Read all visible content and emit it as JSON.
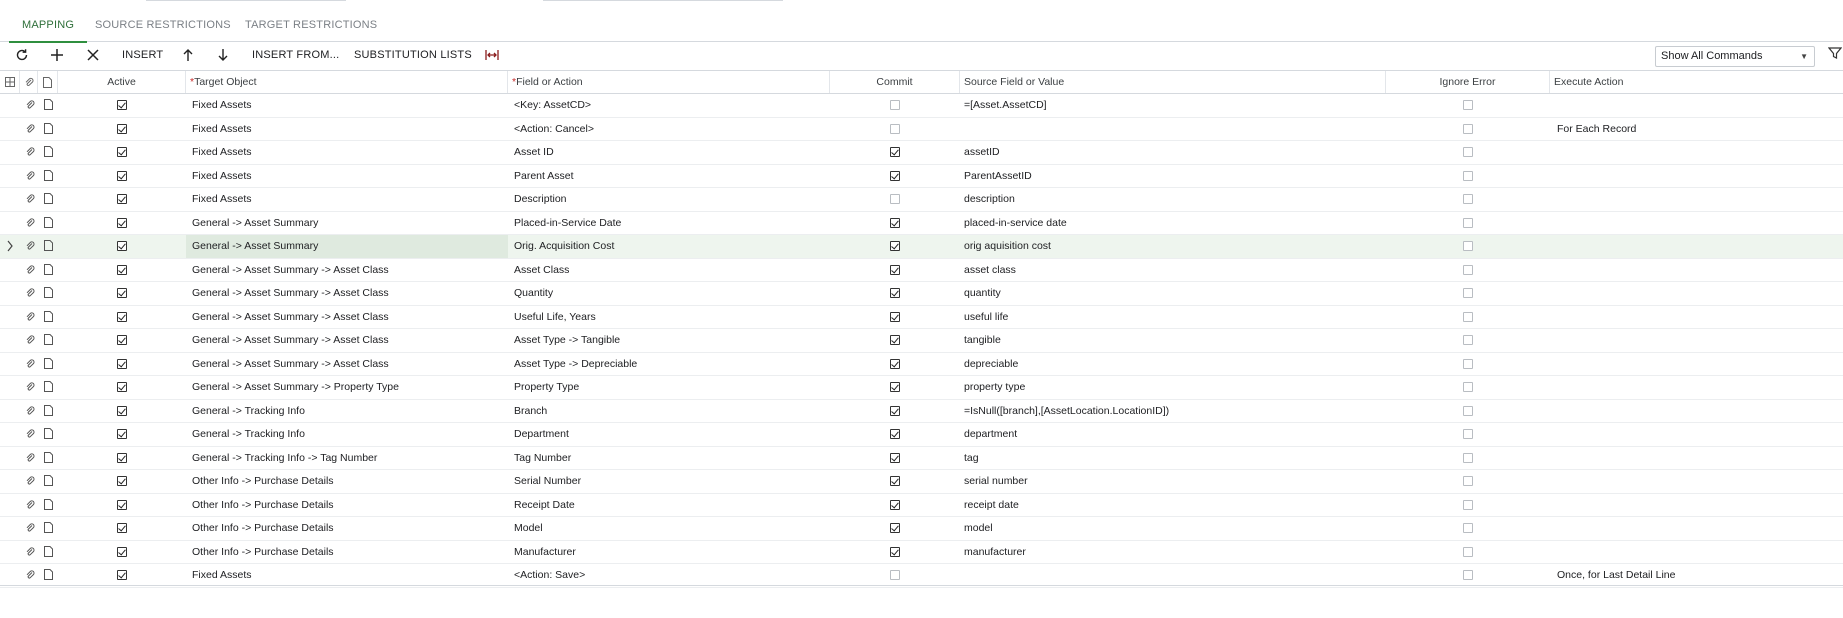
{
  "tabs": [
    {
      "label": "MAPPING",
      "active": true
    },
    {
      "label": "SOURCE RESTRICTIONS",
      "active": false
    },
    {
      "label": "TARGET RESTRICTIONS",
      "active": false
    }
  ],
  "toolbar": {
    "refresh_icon": "refresh-icon",
    "add_icon": "plus-icon",
    "delete_icon": "close-icon",
    "insert_label": "INSERT",
    "move_up_icon": "arrow-up-icon",
    "move_down_icon": "arrow-down-icon",
    "insert_from_label": "INSERT FROM...",
    "substitution_lists_label": "SUBSTITUTION LISTS",
    "fit_columns_icon": "fit-columns-icon",
    "commands_select_value": "Show All Commands",
    "filter_icon": "filter-icon"
  },
  "columns": {
    "active": "Active",
    "target_object": "Target Object",
    "field_or_action": "Field or Action",
    "commit": "Commit",
    "source_field_or_value": "Source Field or Value",
    "ignore_error": "Ignore Error",
    "execute_action": "Execute Action"
  },
  "rows": [
    {
      "active": true,
      "target": "Fixed Assets",
      "field": "<Key: AssetCD>",
      "commit": false,
      "source": "=[Asset.AssetCD]",
      "ignore": false,
      "execute": ""
    },
    {
      "active": true,
      "target": "Fixed Assets",
      "field": "<Action: Cancel>",
      "commit": false,
      "source": "",
      "ignore": false,
      "execute": "For Each Record"
    },
    {
      "active": true,
      "target": "Fixed Assets",
      "field": "Asset ID",
      "commit": true,
      "source": "assetID",
      "ignore": false,
      "execute": ""
    },
    {
      "active": true,
      "target": "Fixed Assets",
      "field": "Parent Asset",
      "commit": true,
      "source": "ParentAssetID",
      "ignore": false,
      "execute": ""
    },
    {
      "active": true,
      "target": "Fixed Assets",
      "field": "Description",
      "commit": false,
      "source": "description",
      "ignore": false,
      "execute": ""
    },
    {
      "active": true,
      "target": "General -> Asset Summary",
      "field": "Placed-in-Service Date",
      "commit": true,
      "source": "placed-in-service date",
      "ignore": false,
      "execute": ""
    },
    {
      "active": true,
      "target": "General -> Asset Summary",
      "field": "Orig. Acquisition Cost",
      "commit": true,
      "source": "orig aquisition cost",
      "ignore": false,
      "execute": "",
      "selected": true
    },
    {
      "active": true,
      "target": "General -> Asset Summary -> Asset Class",
      "field": "Asset Class",
      "commit": true,
      "source": "asset class",
      "ignore": false,
      "execute": ""
    },
    {
      "active": true,
      "target": "General -> Asset Summary -> Asset Class",
      "field": "Quantity",
      "commit": true,
      "source": "quantity",
      "ignore": false,
      "execute": ""
    },
    {
      "active": true,
      "target": "General -> Asset Summary -> Asset Class",
      "field": "Useful Life, Years",
      "commit": true,
      "source": "useful life",
      "ignore": false,
      "execute": ""
    },
    {
      "active": true,
      "target": "General -> Asset Summary -> Asset Class",
      "field": "Asset Type -> Tangible",
      "commit": true,
      "source": "tangible",
      "ignore": false,
      "execute": ""
    },
    {
      "active": true,
      "target": "General -> Asset Summary -> Asset Class",
      "field": "Asset Type -> Depreciable",
      "commit": true,
      "source": "depreciable",
      "ignore": false,
      "execute": ""
    },
    {
      "active": true,
      "target": "General -> Asset Summary -> Property Type",
      "field": "Property Type",
      "commit": true,
      "source": "property type",
      "ignore": false,
      "execute": ""
    },
    {
      "active": true,
      "target": "General -> Tracking Info",
      "field": "Branch",
      "commit": true,
      "source": "=IsNull([branch],[AssetLocation.LocationID])",
      "ignore": false,
      "execute": ""
    },
    {
      "active": true,
      "target": "General -> Tracking Info",
      "field": "Department",
      "commit": true,
      "source": "department",
      "ignore": false,
      "execute": ""
    },
    {
      "active": true,
      "target": "General -> Tracking Info -> Tag Number",
      "field": "Tag Number",
      "commit": true,
      "source": "tag",
      "ignore": false,
      "execute": ""
    },
    {
      "active": true,
      "target": "Other Info -> Purchase Details",
      "field": "Serial Number",
      "commit": true,
      "source": "serial number",
      "ignore": false,
      "execute": ""
    },
    {
      "active": true,
      "target": "Other Info -> Purchase Details",
      "field": "Receipt Date",
      "commit": true,
      "source": "receipt date",
      "ignore": false,
      "execute": ""
    },
    {
      "active": true,
      "target": "Other Info -> Purchase Details",
      "field": "Model",
      "commit": true,
      "source": "model",
      "ignore": false,
      "execute": ""
    },
    {
      "active": true,
      "target": "Other Info -> Purchase Details",
      "field": "Manufacturer",
      "commit": true,
      "source": "manufacturer",
      "ignore": false,
      "execute": ""
    },
    {
      "active": true,
      "target": "Fixed Assets",
      "field": "<Action: Save>",
      "commit": false,
      "source": "",
      "ignore": false,
      "execute": "Once, for Last Detail Line"
    }
  ]
}
